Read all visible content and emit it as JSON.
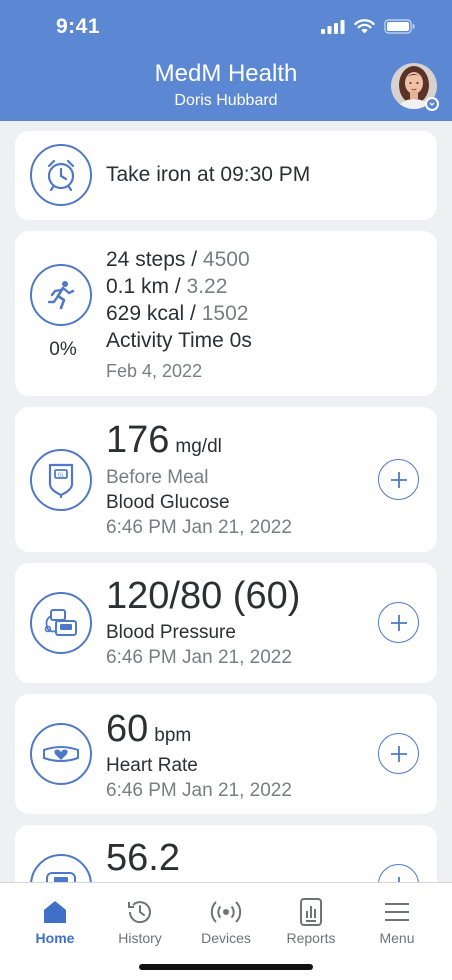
{
  "status_bar": {
    "time": "9:41"
  },
  "header": {
    "title": "MedM Health",
    "subtitle": "Doris Hubbard"
  },
  "reminder": {
    "text": "Take iron at 09:30 PM"
  },
  "activity": {
    "steps": "24 steps",
    "steps_goal": "4500",
    "distance": "0.1 km",
    "distance_goal": "3.22",
    "calories": "629 kcal",
    "calories_goal": "1502",
    "activity_time": "Activity Time 0s",
    "date": "Feb 4, 2022",
    "progress": "0%",
    "sep": " / "
  },
  "glucose": {
    "value": "176",
    "unit": "mg/dl",
    "meal": "Before Meal",
    "label": "Blood Glucose",
    "datetime": "6:46 PM Jan 21, 2022"
  },
  "pressure": {
    "value": "120/80 (60)",
    "label": "Blood Pressure",
    "datetime": "6:46 PM Jan 21, 2022"
  },
  "heart": {
    "value": "60",
    "unit": "bpm",
    "label": "Heart Rate",
    "datetime": "6:46 PM Jan 21, 2022"
  },
  "weight": {
    "value": "56.2"
  },
  "tabs": [
    {
      "label": "Home",
      "icon": "home-icon",
      "active": true
    },
    {
      "label": "History",
      "icon": "history-icon",
      "active": false
    },
    {
      "label": "Devices",
      "icon": "devices-icon",
      "active": false
    },
    {
      "label": "Reports",
      "icon": "reports-icon",
      "active": false
    },
    {
      "label": "Menu",
      "icon": "menu-icon",
      "active": false
    }
  ],
  "colors": {
    "header": "#5b87d3",
    "accent": "#4f79c7",
    "active_tab": "#3f6fc6"
  }
}
